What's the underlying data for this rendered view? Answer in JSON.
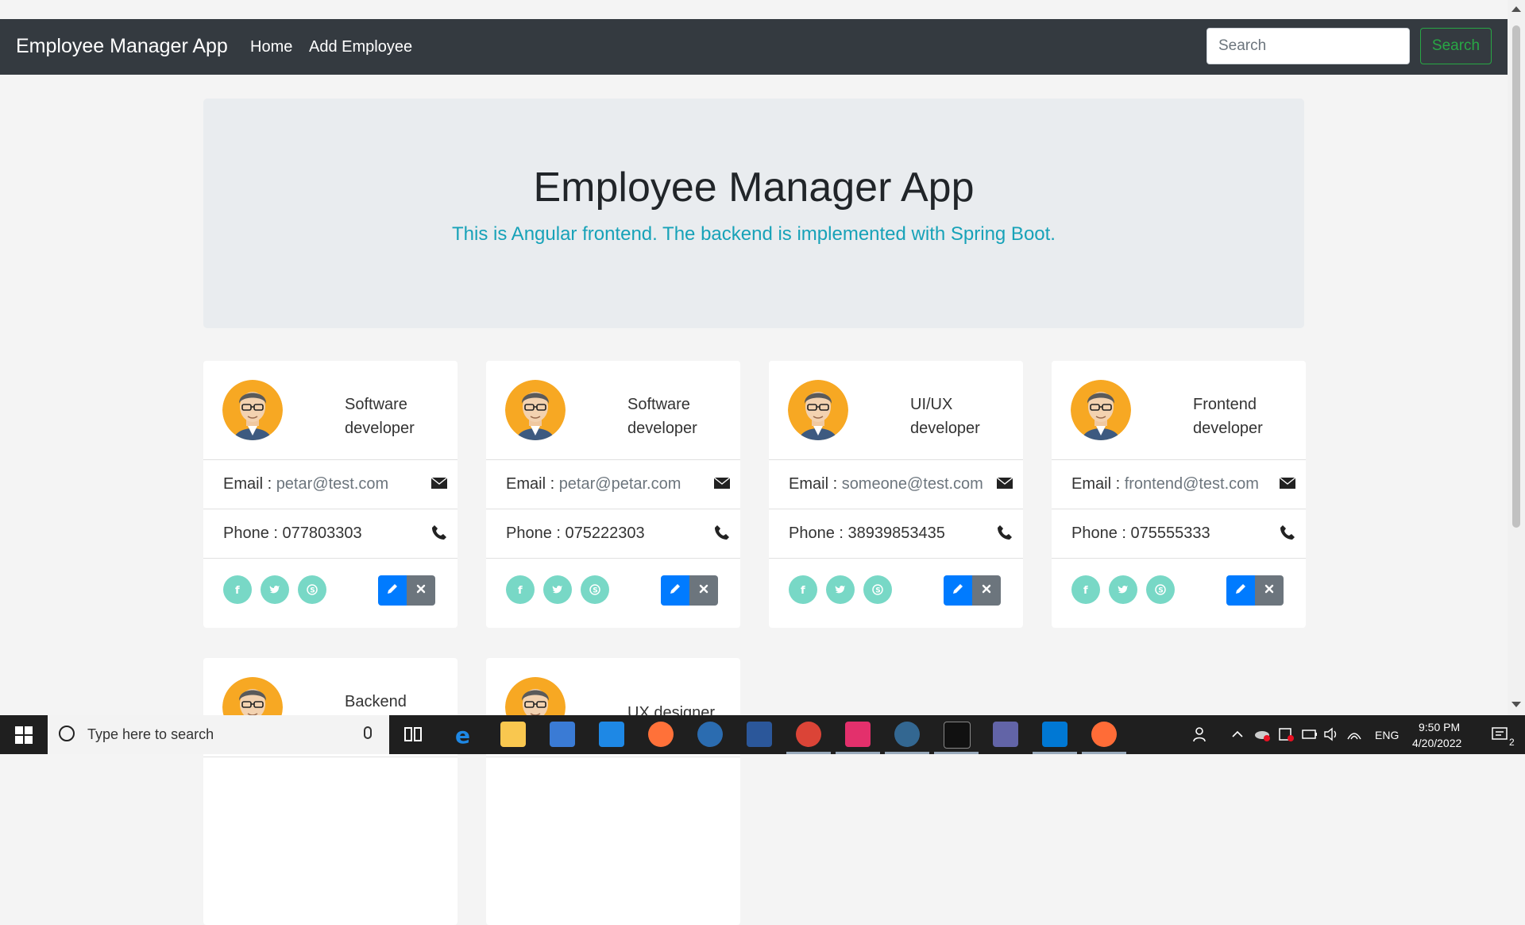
{
  "navbar": {
    "brand": "Employee Manager App",
    "links": [
      "Home",
      "Add Employee"
    ],
    "search_placeholder": "Search",
    "search_button": "Search"
  },
  "jumbotron": {
    "title": "Employee Manager App",
    "subtitle": "This is Angular frontend. The backend is implemented with Spring Boot."
  },
  "employees": [
    {
      "title": "Software developer",
      "email_label": "Email : ",
      "email": "petar@test.com",
      "phone_label": "Phone : ",
      "phone": "077803303"
    },
    {
      "title": "Software developer",
      "email_label": "Email : ",
      "email": "petar@petar.com",
      "phone_label": "Phone : ",
      "phone": "075222303"
    },
    {
      "title": "UI/UX developer",
      "email_label": "Email : ",
      "email": "someone@test.com",
      "phone_label": "Phone : ",
      "phone": "38939853435"
    },
    {
      "title": "Frontend developer",
      "email_label": "Email : ",
      "email": "frontend@test.com",
      "phone_label": "Phone : ",
      "phone": "075555333"
    },
    {
      "title": "Backend"
    },
    {
      "title": "UX designer"
    }
  ],
  "taskbar": {
    "search_placeholder": "Type here to search",
    "language": "ENG",
    "time": "9:50 PM",
    "date": "4/20/2022",
    "notification_count": "2"
  },
  "colors": {
    "navbar": "#343a40",
    "jumbotron": "#e9ecef",
    "subtitle": "#17a2b8",
    "search_button": "#28a745",
    "social": "#78d8c6",
    "edit": "#007bff",
    "delete": "#6c757d"
  }
}
